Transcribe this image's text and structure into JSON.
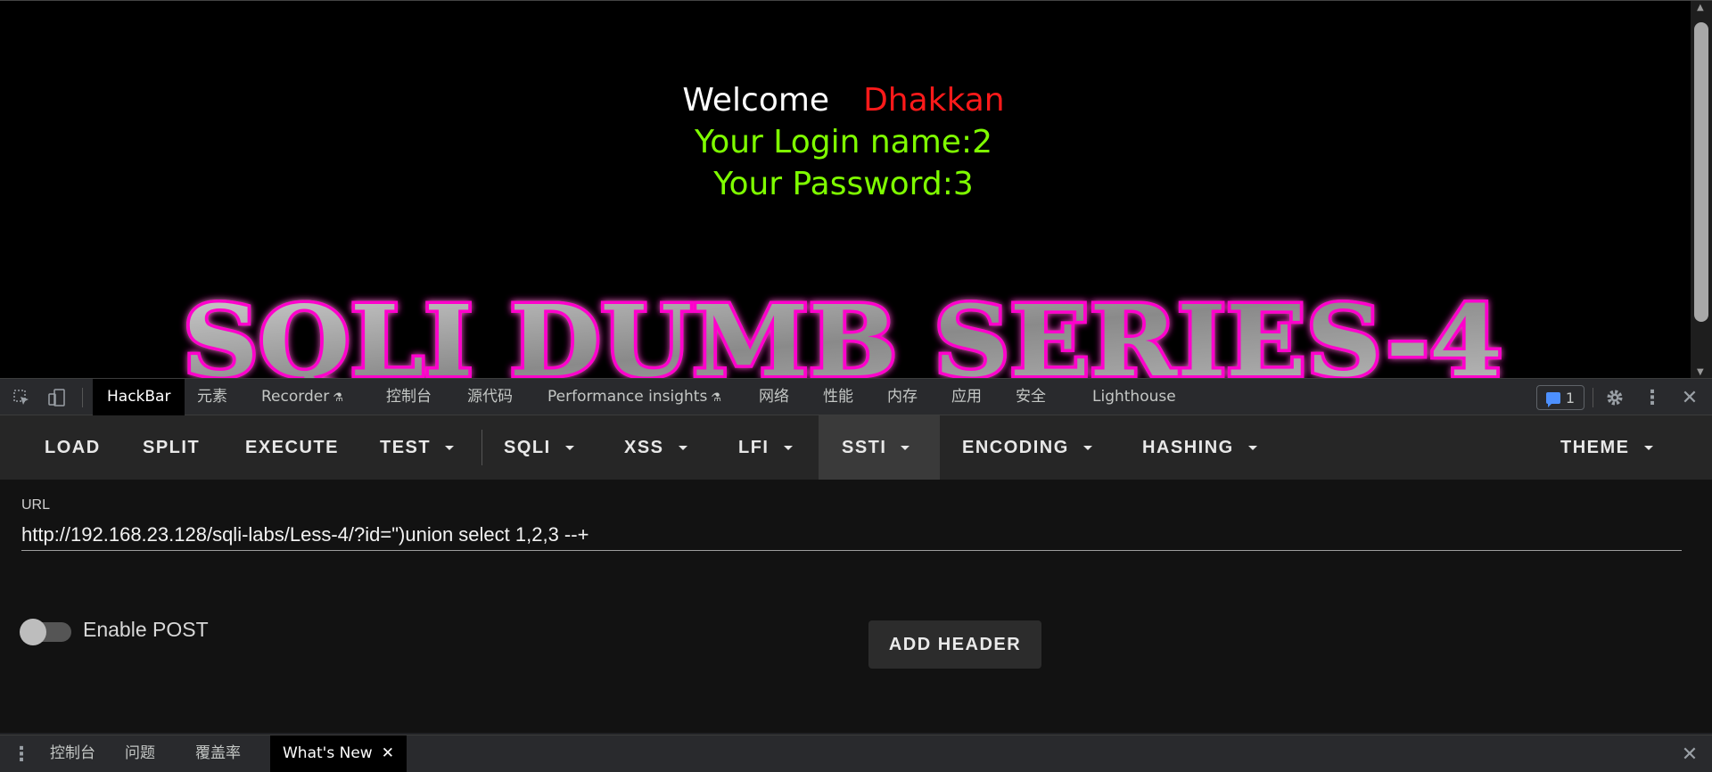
{
  "page": {
    "welcome": "Welcome",
    "name": "Dhakkan",
    "login_line": "Your Login name:2",
    "password_line": "Your Password:3",
    "banner_text": "SQLI DUMB SERIES-4"
  },
  "devtools": {
    "tabs": [
      {
        "label": "HackBar",
        "active": true
      },
      {
        "label": "元素"
      },
      {
        "label": "Recorder"
      },
      {
        "label": "控制台"
      },
      {
        "label": "源代码"
      },
      {
        "label": "Performance insights"
      },
      {
        "label": "网络"
      },
      {
        "label": "性能"
      },
      {
        "label": "内存"
      },
      {
        "label": "应用"
      },
      {
        "label": "安全"
      },
      {
        "label": "Lighthouse"
      }
    ],
    "issues_count": "1"
  },
  "hackbar": {
    "menu": {
      "load": "LOAD",
      "split": "SPLIT",
      "execute": "EXECUTE",
      "test": "TEST",
      "sqli": "SQLI",
      "xss": "XSS",
      "lfi": "LFI",
      "ssti": "SSTI",
      "encoding": "ENCODING",
      "hashing": "HASHING",
      "theme": "THEME"
    },
    "url_label": "URL",
    "url_value": "http://192.168.23.128/sqli-labs/Less-4/?id=\")union select 1,2,3 --+",
    "enable_post_label": "Enable POST",
    "enable_post_on": false,
    "add_header_label": "ADD HEADER"
  },
  "drawer": {
    "tabs": [
      {
        "label": "控制台"
      },
      {
        "label": "问题"
      },
      {
        "label": "覆盖率"
      },
      {
        "label": "What's New",
        "active": true
      }
    ]
  }
}
